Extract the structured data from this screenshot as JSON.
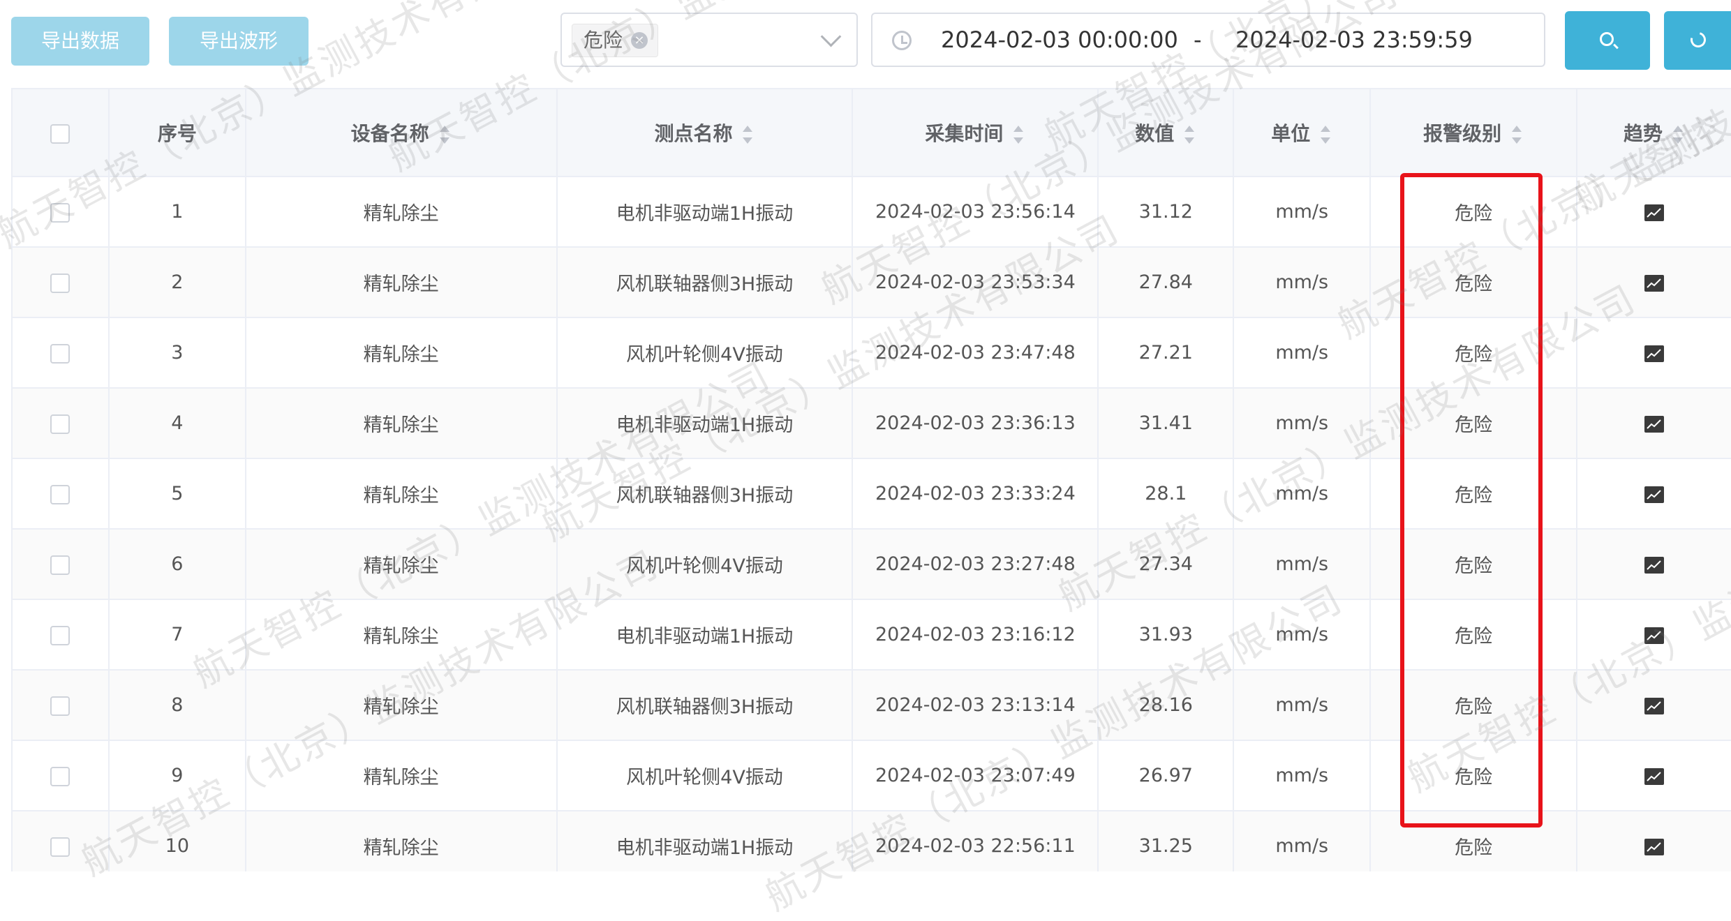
{
  "toolbar": {
    "export_data_label": "导出数据",
    "export_waveform_label": "导出波形",
    "level_filter_tag": "危险",
    "date_start": "2024-02-03 00:00:00",
    "date_separator": "-",
    "date_end": "2024-02-03 23:59:59",
    "search_icon": "search-icon",
    "refresh_icon": "refresh-icon"
  },
  "table": {
    "columns": [
      "序号",
      "设备名称",
      "测点名称",
      "采集时间",
      "数值",
      "单位",
      "报警级别",
      "趋势"
    ],
    "rows": [
      {
        "index": "1",
        "device": "精轧除尘",
        "point": "电机非驱动端1H振动",
        "time": "2024-02-03 23:56:14",
        "value": "31.12",
        "unit": "mm/s",
        "level": "危险"
      },
      {
        "index": "2",
        "device": "精轧除尘",
        "point": "风机联轴器侧3H振动",
        "time": "2024-02-03 23:53:34",
        "value": "27.84",
        "unit": "mm/s",
        "level": "危险"
      },
      {
        "index": "3",
        "device": "精轧除尘",
        "point": "风机叶轮侧4V振动",
        "time": "2024-02-03 23:47:48",
        "value": "27.21",
        "unit": "mm/s",
        "level": "危险"
      },
      {
        "index": "4",
        "device": "精轧除尘",
        "point": "电机非驱动端1H振动",
        "time": "2024-02-03 23:36:13",
        "value": "31.41",
        "unit": "mm/s",
        "level": "危险"
      },
      {
        "index": "5",
        "device": "精轧除尘",
        "point": "风机联轴器侧3H振动",
        "time": "2024-02-03 23:33:24",
        "value": "28.1",
        "unit": "mm/s",
        "level": "危险"
      },
      {
        "index": "6",
        "device": "精轧除尘",
        "point": "风机叶轮侧4V振动",
        "time": "2024-02-03 23:27:48",
        "value": "27.34",
        "unit": "mm/s",
        "level": "危险"
      },
      {
        "index": "7",
        "device": "精轧除尘",
        "point": "电机非驱动端1H振动",
        "time": "2024-02-03 23:16:12",
        "value": "31.93",
        "unit": "mm/s",
        "level": "危险"
      },
      {
        "index": "8",
        "device": "精轧除尘",
        "point": "风机联轴器侧3H振动",
        "time": "2024-02-03 23:13:14",
        "value": "28.16",
        "unit": "mm/s",
        "level": "危险"
      },
      {
        "index": "9",
        "device": "精轧除尘",
        "point": "风机叶轮侧4V振动",
        "time": "2024-02-03 23:07:49",
        "value": "26.97",
        "unit": "mm/s",
        "level": "危险"
      },
      {
        "index": "10",
        "device": "精轧除尘",
        "point": "电机非驱动端1H振动",
        "time": "2024-02-03 22:56:11",
        "value": "31.25",
        "unit": "mm/s",
        "level": "危险"
      }
    ]
  },
  "watermark": {
    "text": "航天智控（北京）监测技术有限公司"
  },
  "colors": {
    "primary": "#3fb2d8",
    "export_button": "#9dd6ea",
    "highlight": "#e8131a",
    "header_bg": "#f5f7fa"
  }
}
